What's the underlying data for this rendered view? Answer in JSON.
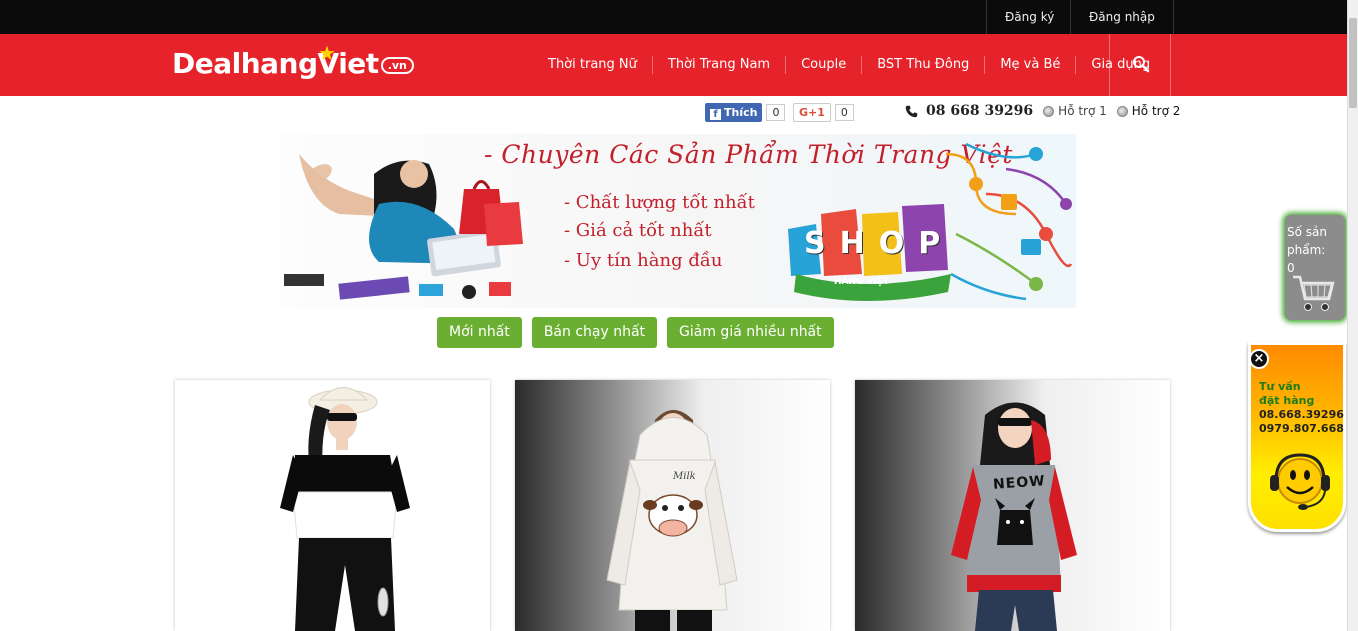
{
  "account": {
    "register": "Đăng ký",
    "login": "Đăng nhập"
  },
  "logo": {
    "brand": "DealhangViet",
    "tld": ".vn"
  },
  "menu": [
    {
      "label": "Thời trang Nữ"
    },
    {
      "label": "Thời Trang Nam"
    },
    {
      "label": "Couple"
    },
    {
      "label": "BST Thu Đông"
    },
    {
      "label": "Mẹ và Bé"
    },
    {
      "label": "Gia dụng"
    }
  ],
  "social": {
    "like_label": "Thích",
    "like_count": "0",
    "gplus_label": "G+1",
    "gplus_count": "0"
  },
  "contact": {
    "phone": "08 668 39296",
    "support1": "Hỗ trợ 1",
    "support2": "Hỗ trợ 2"
  },
  "banner": {
    "title": "- Chuyên Các Sản Phẩm Thời Trang Việt",
    "lines": [
      "-  Chất lượng tốt nhất",
      "-  Giá cả tốt nhất",
      "-  Uy tín hàng đầu"
    ],
    "shop_word": "SHOP",
    "ribbon": "HÀNG VIỆT"
  },
  "tabs": [
    {
      "label": "Mới nhất"
    },
    {
      "label": "Bán chạy nhất"
    },
    {
      "label": "Giảm giá nhiều nhất"
    }
  ],
  "products": [
    {
      "name": "product-1",
      "print": ""
    },
    {
      "name": "product-2",
      "print": "Milk"
    },
    {
      "name": "product-3",
      "print": "NEOW"
    }
  ],
  "cart": {
    "label": "Số sản phẩm:",
    "count": "0"
  },
  "consult": {
    "line1": "Tư vấn",
    "line2": "đặt hàng",
    "phone1": "08.668.39296",
    "phone2": "0979.807.668",
    "close": "×"
  },
  "colors": {
    "brand_red": "#e6232a",
    "tab_green": "#6aaf31",
    "topbar": "#0b0b0b"
  }
}
